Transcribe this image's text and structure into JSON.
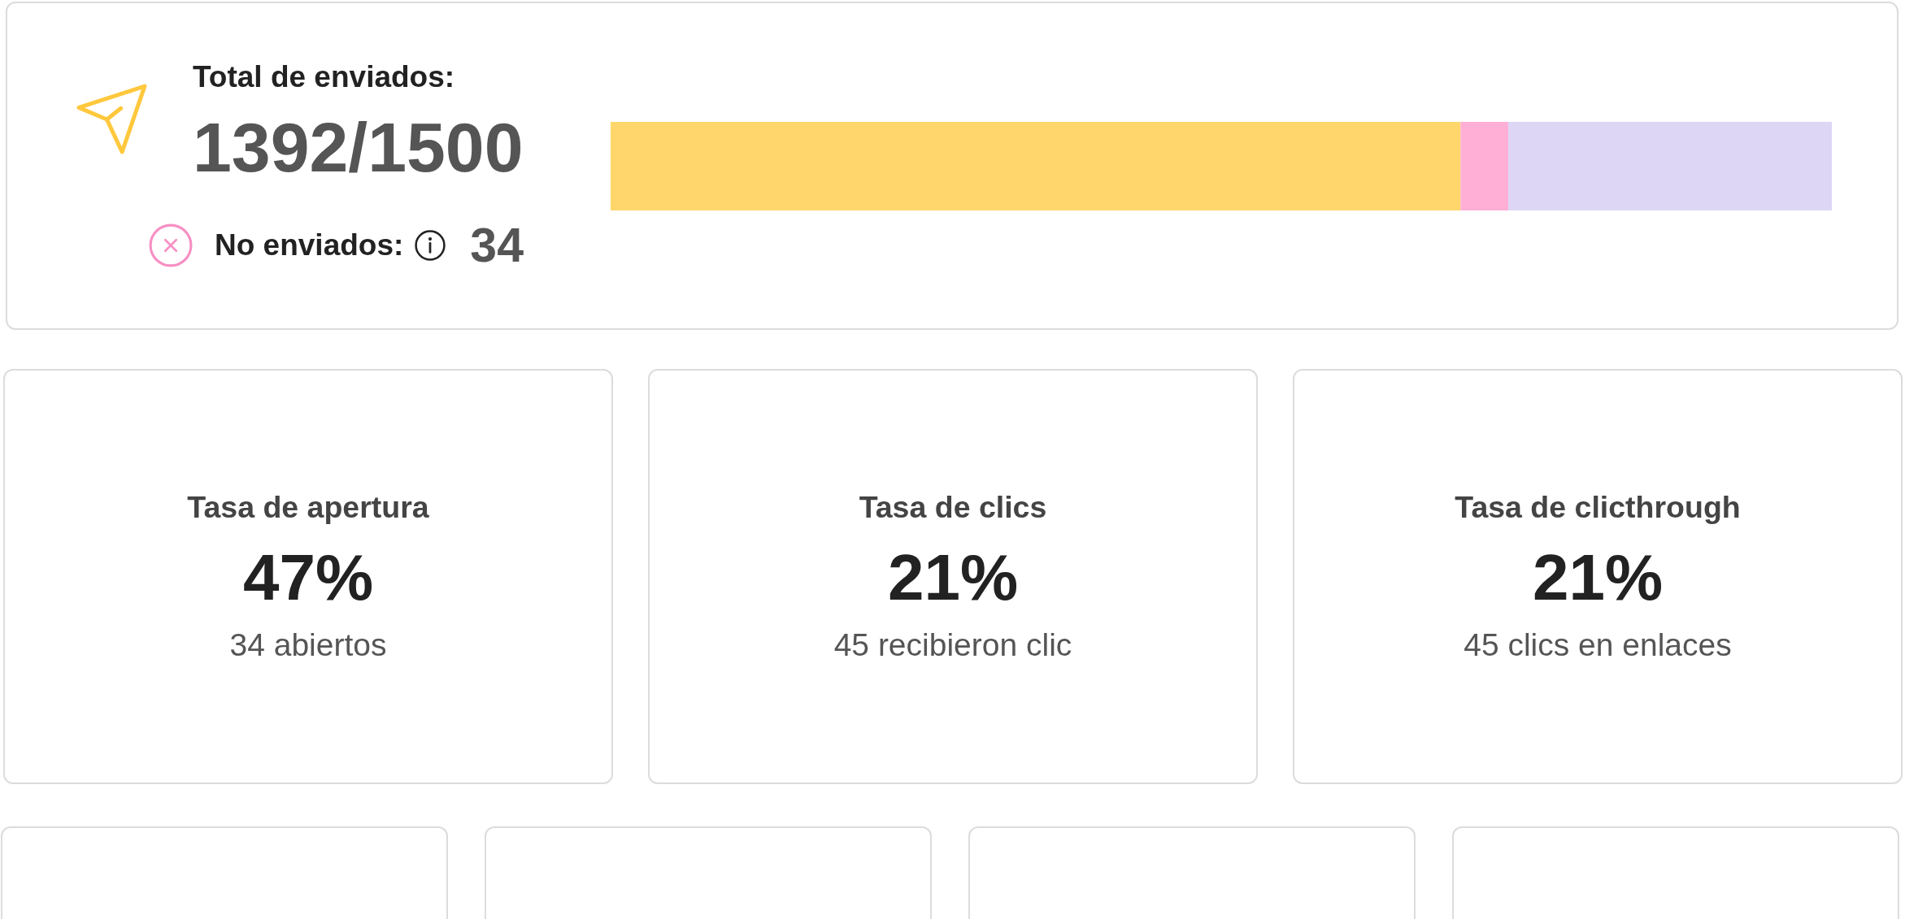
{
  "summary": {
    "title": "Total de enviados:",
    "value": "1392/1500",
    "not_sent": {
      "label": "No enviados:",
      "value": "34"
    }
  },
  "metrics": [
    {
      "title": "Tasa de apertura",
      "value": "47%",
      "detail": "34 abiertos"
    },
    {
      "title": "Tasa de clics",
      "value": "21%",
      "detail": "45 recibieron clic"
    },
    {
      "title": "Tasa de clicthrough",
      "value": "21%",
      "detail": "45 clics en enlaces"
    }
  ],
  "lower_cards": [
    {
      "kind": "blank"
    },
    {
      "kind": "blank"
    },
    {
      "kind": "blank"
    },
    {
      "kind": "blank"
    }
  ]
}
